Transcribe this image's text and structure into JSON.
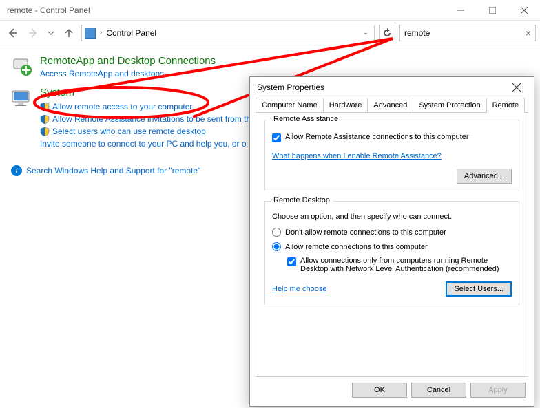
{
  "window": {
    "title": "remote - Control Panel"
  },
  "address": {
    "location": "Control Panel"
  },
  "search": {
    "value": "remote"
  },
  "results": {
    "remoteapp": {
      "heading": "RemoteApp and Desktop Connections",
      "sub": "Access RemoteApp and desktops"
    },
    "system": {
      "heading": "System",
      "items": [
        "Allow remote access to your computer",
        "Allow Remote Assistance invitations to be sent from th",
        "Select users who can use remote desktop",
        "Invite someone to connect to your PC and help you, or o"
      ]
    },
    "help_link": "Search Windows Help and Support for \"remote\""
  },
  "dialog": {
    "title": "System Properties",
    "tabs": [
      "Computer Name",
      "Hardware",
      "Advanced",
      "System Protection",
      "Remote"
    ],
    "active_tab": "Remote",
    "remote_assistance": {
      "legend": "Remote Assistance",
      "checkbox_label": "Allow Remote Assistance connections to this computer",
      "checked": true,
      "help_link": "What happens when I enable Remote Assistance?",
      "advanced_btn": "Advanced..."
    },
    "remote_desktop": {
      "legend": "Remote Desktop",
      "desc": "Choose an option, and then specify who can connect.",
      "option_off": "Don't allow remote connections to this computer",
      "option_on": "Allow remote connections to this computer",
      "selected": "on",
      "nla_label": "Allow connections only from computers running Remote Desktop with Network Level Authentication (recommended)",
      "nla_checked": true,
      "help_link": "Help me choose",
      "select_users_btn": "Select Users..."
    },
    "buttons": {
      "ok": "OK",
      "cancel": "Cancel",
      "apply": "Apply"
    }
  }
}
